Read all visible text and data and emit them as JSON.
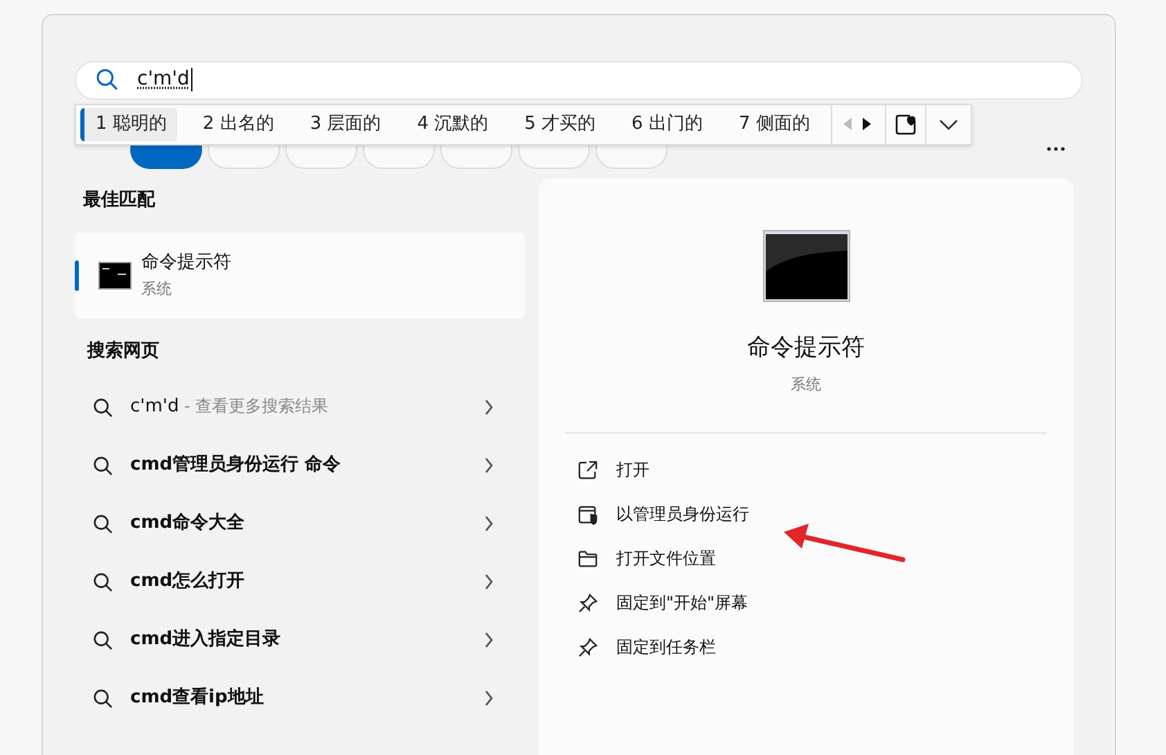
{
  "search": {
    "value": "c'm'd"
  },
  "ime_candidates": {
    "items": [
      {
        "label": "1 聪明的",
        "selected": true
      },
      {
        "label": "2 出名的",
        "selected": false
      },
      {
        "label": "3 层面的",
        "selected": false
      },
      {
        "label": "4 沉默的",
        "selected": false
      },
      {
        "label": "5 才买的",
        "selected": false
      },
      {
        "label": "6 出门的",
        "selected": false
      },
      {
        "label": "7 侧面的",
        "selected": false
      }
    ],
    "prev_disabled": true,
    "next_disabled": false
  },
  "filter_chips": [
    {
      "selected": true
    },
    {
      "selected": false
    },
    {
      "selected": false
    },
    {
      "selected": false
    },
    {
      "selected": false
    },
    {
      "selected": false
    },
    {
      "selected": false
    }
  ],
  "best_match": {
    "heading": "最佳匹配",
    "title": "命令提示符",
    "subtitle": "系统",
    "selected": true
  },
  "web_search": {
    "heading": "搜索网页",
    "items": [
      {
        "query": "c'm'd",
        "hint": " - 查看更多搜索结果",
        "bold": false
      },
      {
        "query": "cmd管理员身份运行 命令",
        "bold": true
      },
      {
        "query": "cmd命令大全",
        "bold": true
      },
      {
        "query": "cmd怎么打开",
        "bold": true
      },
      {
        "query": "cmd进入指定目录",
        "bold": true
      },
      {
        "query": "cmd查看ip地址",
        "bold": true
      }
    ]
  },
  "detail": {
    "title": "命令提示符",
    "subtitle": "系统",
    "actions": [
      {
        "kind": "open",
        "label": "打开"
      },
      {
        "kind": "admin",
        "label": "以管理员身份运行"
      },
      {
        "kind": "folder",
        "label": "打开文件位置"
      },
      {
        "kind": "pin",
        "label": "固定到\"开始\"屏幕"
      },
      {
        "kind": "pin",
        "label": "固定到任务栏"
      }
    ]
  }
}
